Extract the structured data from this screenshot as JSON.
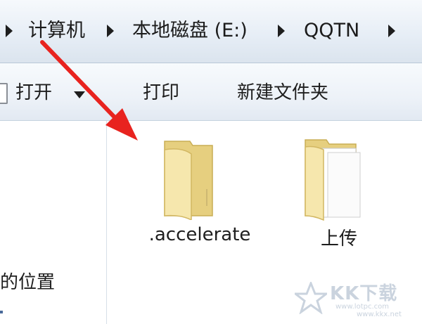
{
  "breadcrumb": {
    "items": [
      "计算机",
      "本地磁盘 (E:)",
      "QQTN"
    ]
  },
  "toolbar": {
    "open_label": "打开",
    "print_label": "打印",
    "new_folder_label": "新建文件夹"
  },
  "navpane": {
    "partial_item": "的位置"
  },
  "files": [
    {
      "name": ".accelerate",
      "icon": "empty-folder-icon"
    },
    {
      "name": "上传",
      "icon": "folder-with-documents-icon"
    }
  ],
  "watermark": {
    "text": "KK下载",
    "url1": "www.lotpc.com",
    "url2": "www.kkx.net"
  },
  "colors": {
    "annotation_arrow": "#e8231f",
    "folder_back": "#e6cf7f",
    "folder_front": "#f6e7ad"
  }
}
